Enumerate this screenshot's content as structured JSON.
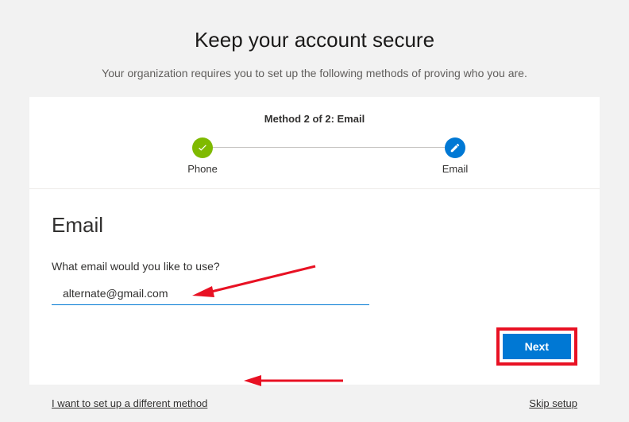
{
  "header": {
    "title": "Keep your account secure",
    "subtitle": "Your organization requires you to set up the following methods of proving who you are."
  },
  "progress": {
    "method_count_label": "Method 2 of 2: Email",
    "steps": [
      {
        "label": "Phone",
        "state": "done"
      },
      {
        "label": "Email",
        "state": "active"
      }
    ]
  },
  "email_section": {
    "heading": "Email",
    "prompt": "What email would you like to use?",
    "value": "alternate@gmail.com"
  },
  "actions": {
    "next_label": "Next"
  },
  "footer": {
    "different_method_link": "I want to set up a different method",
    "skip_link": "Skip setup"
  }
}
